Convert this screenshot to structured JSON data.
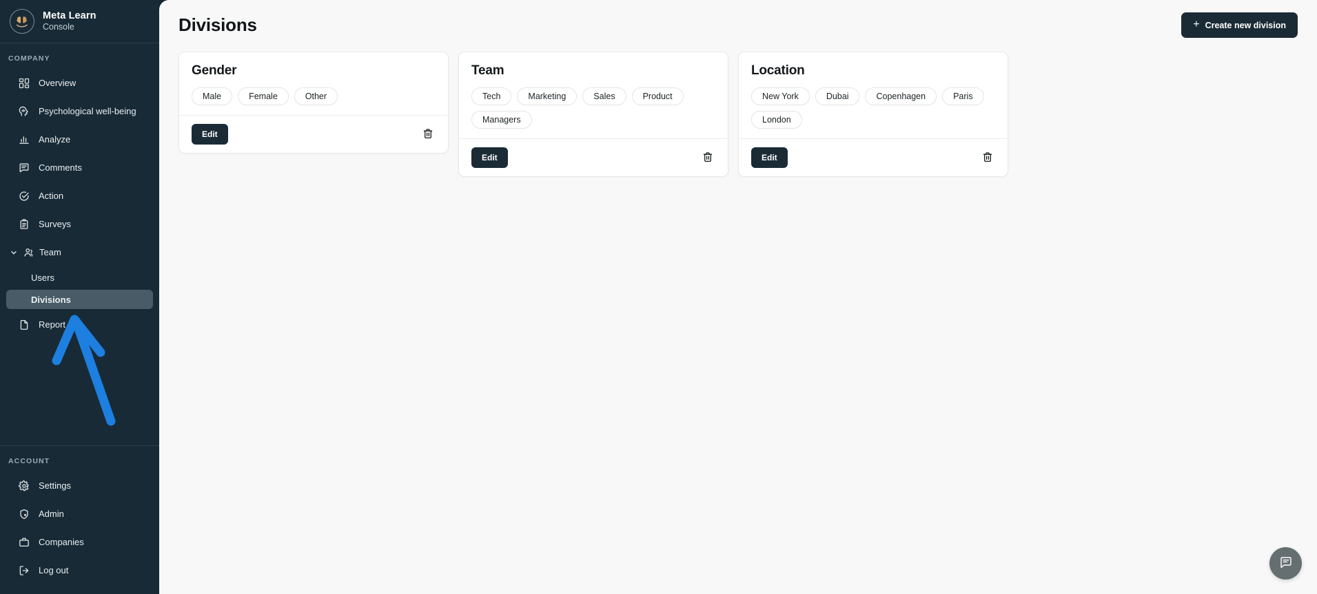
{
  "brand": {
    "title": "Meta Learn",
    "subtitle": "Console",
    "logo_icon": "brain-on-hand-icon"
  },
  "sidebar": {
    "sections": [
      {
        "label": "COMPANY"
      },
      {
        "label": "ACCOUNT"
      }
    ],
    "company_items": [
      {
        "label": "Overview",
        "icon": "dashboard-grid-icon"
      },
      {
        "label": "Psychological well-being",
        "icon": "head-pulse-icon"
      },
      {
        "label": "Analyze",
        "icon": "bar-chart-icon"
      },
      {
        "label": "Comments",
        "icon": "comment-lines-icon"
      },
      {
        "label": "Action",
        "icon": "check-circle-icon"
      },
      {
        "label": "Surveys",
        "icon": "clipboard-icon"
      }
    ],
    "team_group": {
      "label": "Team",
      "icon": "users-icon",
      "chevron": "chevron-down-icon",
      "expanded": true,
      "children": [
        {
          "label": "Users",
          "active": false
        },
        {
          "label": "Divisions",
          "active": true
        }
      ]
    },
    "report_item": {
      "label": "Report",
      "icon": "document-icon"
    },
    "account_items": [
      {
        "label": "Settings",
        "icon": "gear-icon"
      },
      {
        "label": "Admin",
        "icon": "shield-user-icon"
      },
      {
        "label": "Companies",
        "icon": "briefcase-icon"
      },
      {
        "label": "Log out",
        "icon": "logout-icon"
      }
    ]
  },
  "header": {
    "title": "Divisions",
    "create_button": {
      "label": "Create new division",
      "icon": "plus-icon"
    }
  },
  "cards": [
    {
      "title": "Gender",
      "tags": [
        "Male",
        "Female",
        "Other"
      ],
      "edit_label": "Edit",
      "delete_icon": "trash-icon"
    },
    {
      "title": "Team",
      "tags": [
        "Tech",
        "Marketing",
        "Sales",
        "Product",
        "Managers"
      ],
      "edit_label": "Edit",
      "delete_icon": "trash-icon"
    },
    {
      "title": "Location",
      "tags": [
        "New York",
        "Dubai",
        "Copenhagen",
        "Paris",
        "London"
      ],
      "edit_label": "Edit",
      "delete_icon": "trash-icon"
    }
  ],
  "chat_fab": {
    "icon": "chat-bubble-icon"
  },
  "annotation": {
    "type": "arrow",
    "color": "#1d7fe0",
    "points_to": "Divisions"
  },
  "colors": {
    "sidebar_bg": "#182a36",
    "page_bg": "#f8f8f8",
    "accent_dark": "#1b2b36",
    "active_item": "#adbec7",
    "annotation_blue": "#1d7fe0"
  }
}
